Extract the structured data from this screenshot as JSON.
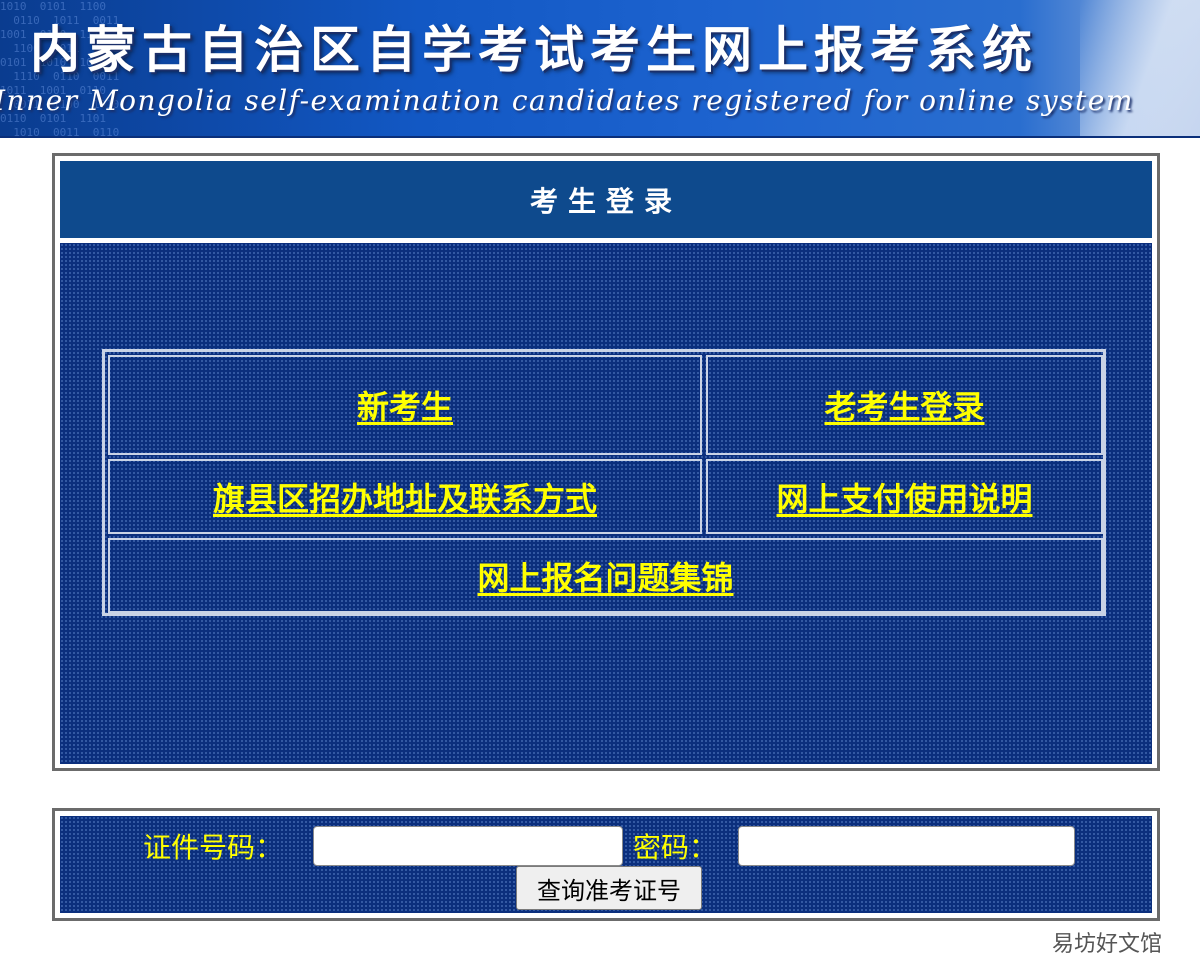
{
  "banner": {
    "title_cn": "内蒙古自治区自学考试考生网上报考系统",
    "title_en": "Inner Mongolia self-examination candidates registered for online system"
  },
  "login_panel": {
    "title": "考生登录",
    "links": {
      "new_candidate": "新考生",
      "returning_login": "老考生登录",
      "office_contacts": "旗县区招办地址及联系方式",
      "payment_guide": "网上支付使用说明",
      "faq": "网上报名问题集锦"
    }
  },
  "query_panel": {
    "id_label": "证件号码：",
    "id_value": "",
    "password_label": "密码：",
    "password_value": "",
    "submit_label": "查询准考证号"
  },
  "watermark": "易坊好文馆",
  "colors": {
    "panel_header": "#0e4a8d",
    "panel_body": "#0b2f7d",
    "link": "#ffff00",
    "label": "#ffff00"
  }
}
